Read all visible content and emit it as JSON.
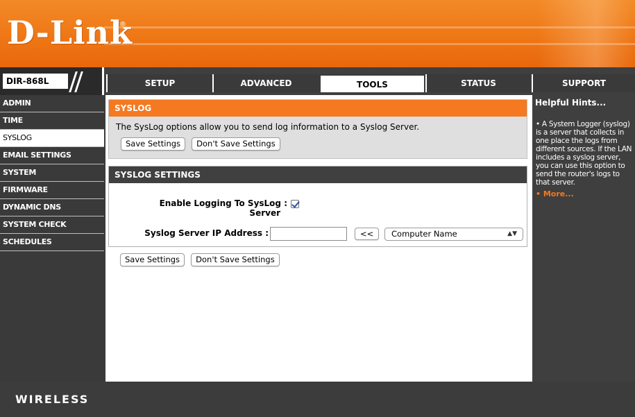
{
  "brand": {
    "logo": "D-Link",
    "reg_mark": "®",
    "model": "DIR-868L"
  },
  "tabs": [
    {
      "label": "SETUP"
    },
    {
      "label": "ADVANCED"
    },
    {
      "label": "TOOLS",
      "active": true
    },
    {
      "label": "STATUS"
    },
    {
      "label": "SUPPORT"
    }
  ],
  "menu": [
    {
      "label": "ADMIN"
    },
    {
      "label": "TIME"
    },
    {
      "label": "SYSLOG",
      "active": true
    },
    {
      "label": "EMAIL SETTINGS"
    },
    {
      "label": "SYSTEM"
    },
    {
      "label": "FIRMWARE"
    },
    {
      "label": "DYNAMIC DNS"
    },
    {
      "label": "SYSTEM CHECK"
    },
    {
      "label": "SCHEDULES"
    }
  ],
  "syslog": {
    "title": "SYSLOG",
    "description": "The SysLog options allow you to send log information to a Syslog Server.",
    "save_label": "Save Settings",
    "dont_save_label": "Don't Save Settings"
  },
  "settings": {
    "title": "SYSLOG SETTINGS",
    "enable_label_line1": "Enable Logging To SysLog :",
    "enable_label_line2": "Server",
    "enable_checked": true,
    "ip_label": "Syslog Server IP Address :",
    "ip_value": "",
    "copy_label": "<<",
    "select_value": "Computer Name",
    "select_arrows": "▲▼"
  },
  "bottom_buttons": {
    "save_label": "Save Settings",
    "dont_save_label": "Don't Save Settings"
  },
  "hints": {
    "title": "Helpful Hints...",
    "text": "• A System Logger (syslog) is a server that collects in one place the logs from different sources. If the LAN includes a syslog server, you can use this option to send the router's logs to that server.",
    "more": "• More..."
  },
  "footer": {
    "label": "WIRELESS"
  },
  "colors": {
    "orange": "#f47920",
    "dark": "#3f3f3f",
    "check": "#2a4fa0"
  }
}
